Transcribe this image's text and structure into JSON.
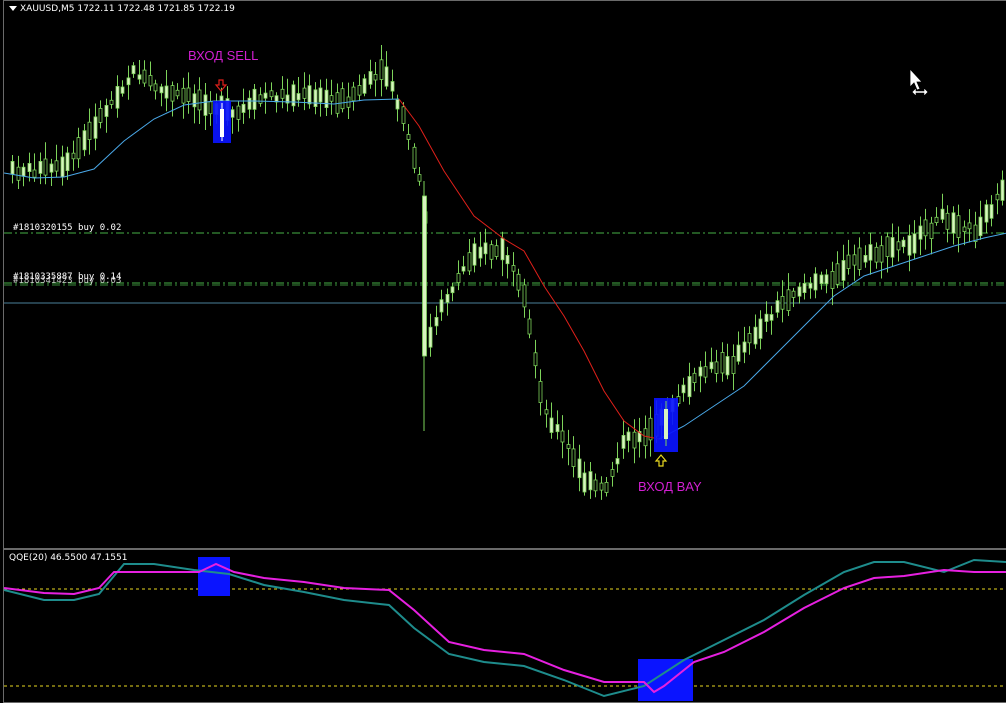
{
  "chart": {
    "symbol_header": "XAUUSD,M5  1722.11 1722.48 1721.85 1722.19",
    "orders": [
      {
        "label": "#1810320155 buy 0.02"
      },
      {
        "label": "#1810335887 buy 0.14"
      },
      {
        "label": "#1810341423 buy 0.03"
      }
    ],
    "signals": {
      "sell_label": "ВХОД SELL",
      "buy_label": "ВХОД BAY"
    }
  },
  "indicator": {
    "header": "QQE(20) 46.5500 47.1551"
  },
  "colors": {
    "background": "#000000",
    "bull_candle": "#d8f3c0",
    "bear_candle": "#000000",
    "wick": "#7dd35a",
    "ma_up": "#4aa8e8",
    "ma_down": "#e0201a",
    "order_line": "#46b046",
    "signal_box": "#0a14ff",
    "sell_arrow": "#e0201a",
    "buy_arrow": "#e8d820",
    "qqe_fast": "#e620e0",
    "qqe_slow": "#1e8c8c",
    "level_line": "#e8d820",
    "signal_text": "#d21fd2"
  },
  "icons": {
    "cursor": "mouse-pointer-icon",
    "move": "horizontal-resize-icon"
  }
}
